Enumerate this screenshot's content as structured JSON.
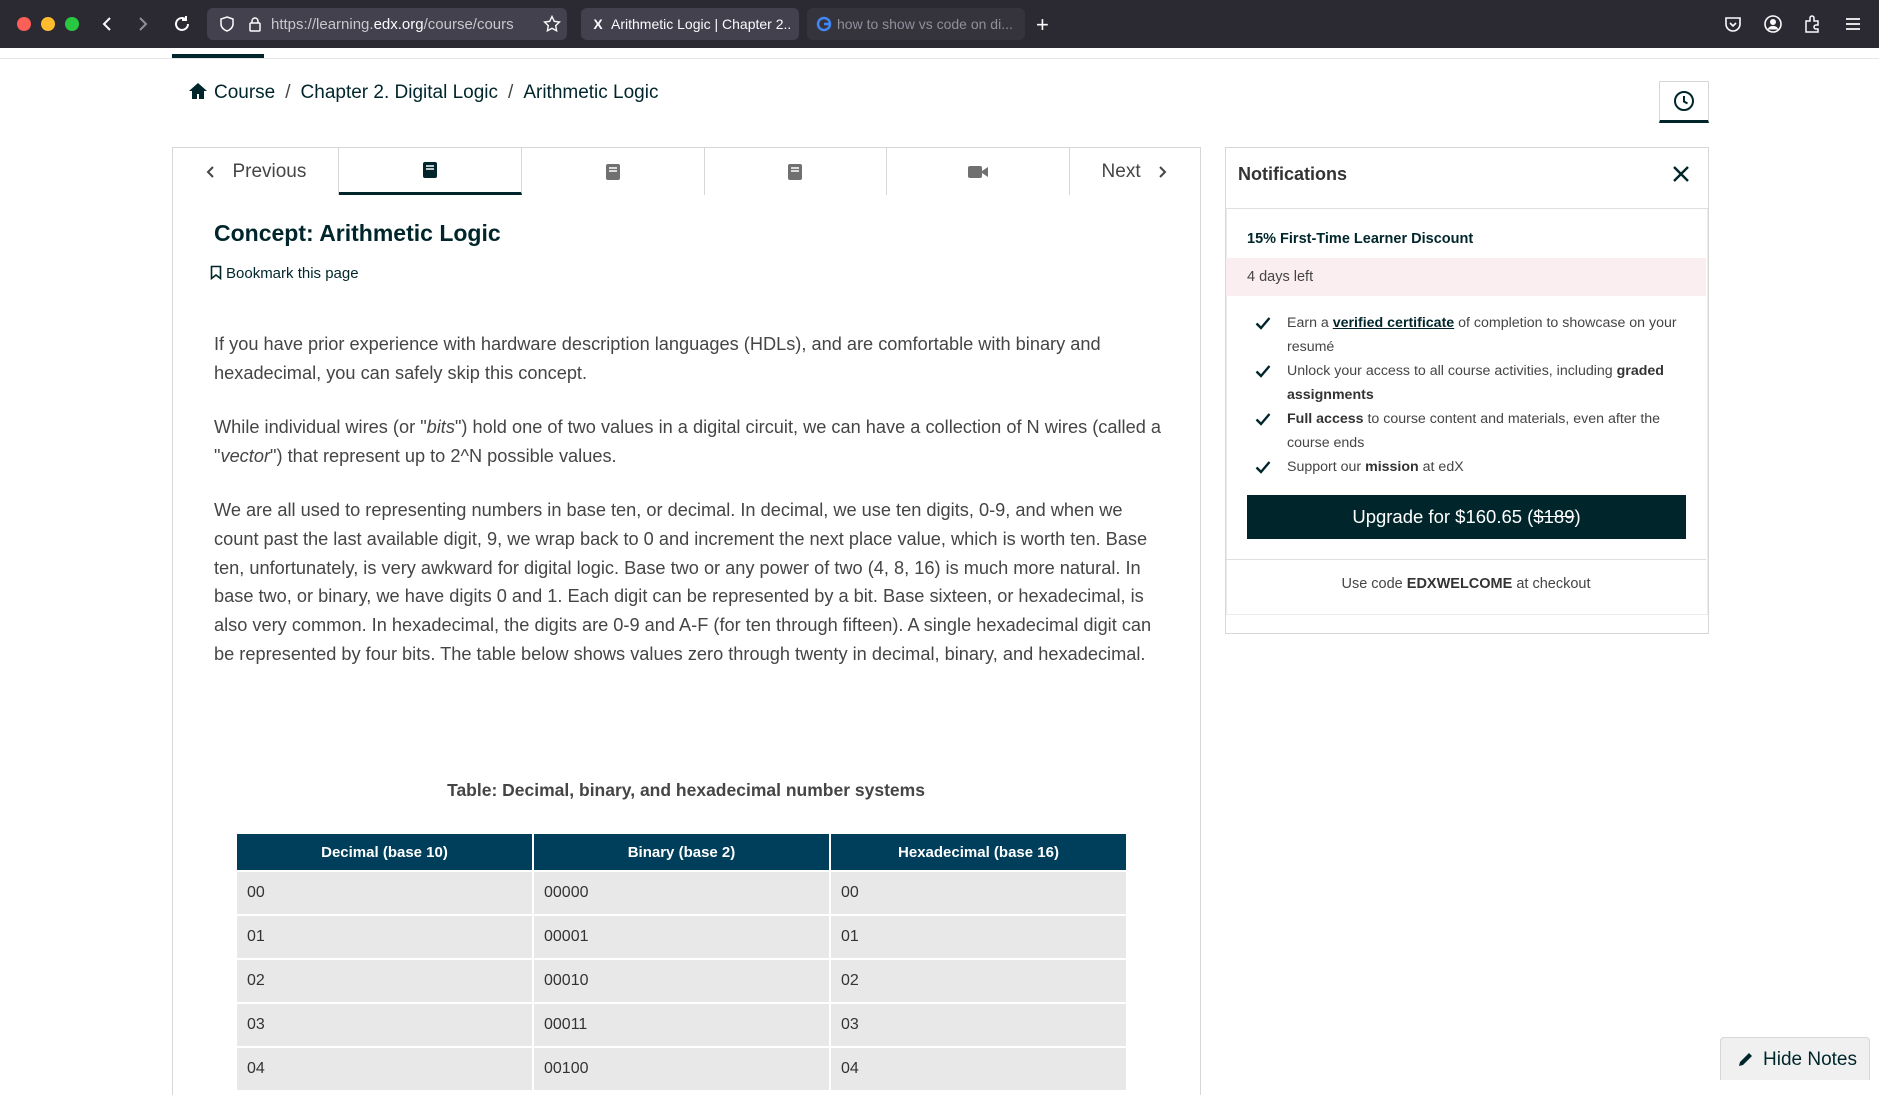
{
  "browser": {
    "url_prefix": "https://learning.",
    "url_host": "edx.org",
    "url_rest": "/course/cours",
    "tabs": [
      {
        "favicon": "edx-icon",
        "title": "Arithmetic Logic | Chapter 2..."
      },
      {
        "favicon": "google-icon",
        "title": "how to show vs code on di..."
      }
    ]
  },
  "breadcrumb": {
    "course": "Course",
    "chapter": "Chapter 2. Digital Logic",
    "unit": "Arithmetic Logic",
    "separator": "/"
  },
  "sequence_nav": {
    "previous": "Previous",
    "next": "Next",
    "units": [
      "book-icon",
      "book-icon",
      "book-icon",
      "video-icon"
    ],
    "active_index": 0
  },
  "unit": {
    "title": "Concept: Arithmetic Logic",
    "bookmark": "Bookmark this page",
    "p1": "If you have prior experience with hardware description languages (HDLs), and are comfortable with binary and hexadecimal, you can safely skip this concept.",
    "p2_a": "While individual wires (or \"",
    "p2_bits": "bits",
    "p2_b": "\") hold one of two values in a digital circuit, we can have a collection of N wires (called a \"",
    "p2_vector": "vector",
    "p2_c": "\") that represent up to 2^N possible values.",
    "p3": "We are all used to representing numbers in base ten, or decimal. In decimal, we use ten digits, 0-9, and when we count past the last available digit, 9, we wrap back to 0 and increment the next place value, which is worth ten. Base ten, unfortunately, is very awkward for digital logic. Base two or any power of two (4, 8, 16) is much more natural. In base two, or binary, we have digits 0 and 1. Each digit can be represented by a bit. Base sixteen, or hexadecimal, is also very common. In hexadecimal, the digits are 0-9 and A-F (for ten through fifteen). A single hexadecimal digit can be represented by four bits. The table below shows values zero through twenty in decimal, binary, and hexadecimal.",
    "table_caption": "Table: Decimal, binary, and hexadecimal number systems"
  },
  "table": {
    "headers": [
      "Decimal (base 10)",
      "Binary (base 2)",
      "Hexadecimal (base 16)"
    ],
    "rows": [
      [
        "00",
        "00000",
        "00"
      ],
      [
        "01",
        "00001",
        "01"
      ],
      [
        "02",
        "00010",
        "02"
      ],
      [
        "03",
        "00011",
        "03"
      ],
      [
        "04",
        "00100",
        "04"
      ]
    ]
  },
  "notifications": {
    "title": "Notifications",
    "promo_title": "15% First-Time Learner Discount",
    "days_left": "4 days left",
    "b1_pre": "Earn a ",
    "b1_link": "verified certificate",
    "b1_post": " of completion to showcase on your resumé",
    "b2_pre": "Unlock your access to all course activities, including ",
    "b2_bold": "graded assignments",
    "b3_bold": "Full access",
    "b3_post": " to course content and materials, even after the course ends",
    "b4_pre": "Support our ",
    "b4_bold": "mission",
    "b4_post": " at edX",
    "upgrade_pre": "Upgrade for $160.65 (",
    "upgrade_strike": "$189",
    "upgrade_post": ")",
    "code_pre": "Use code ",
    "code": "EDXWELCOME",
    "code_post": " at checkout"
  },
  "hide_notes": "Hide Notes"
}
